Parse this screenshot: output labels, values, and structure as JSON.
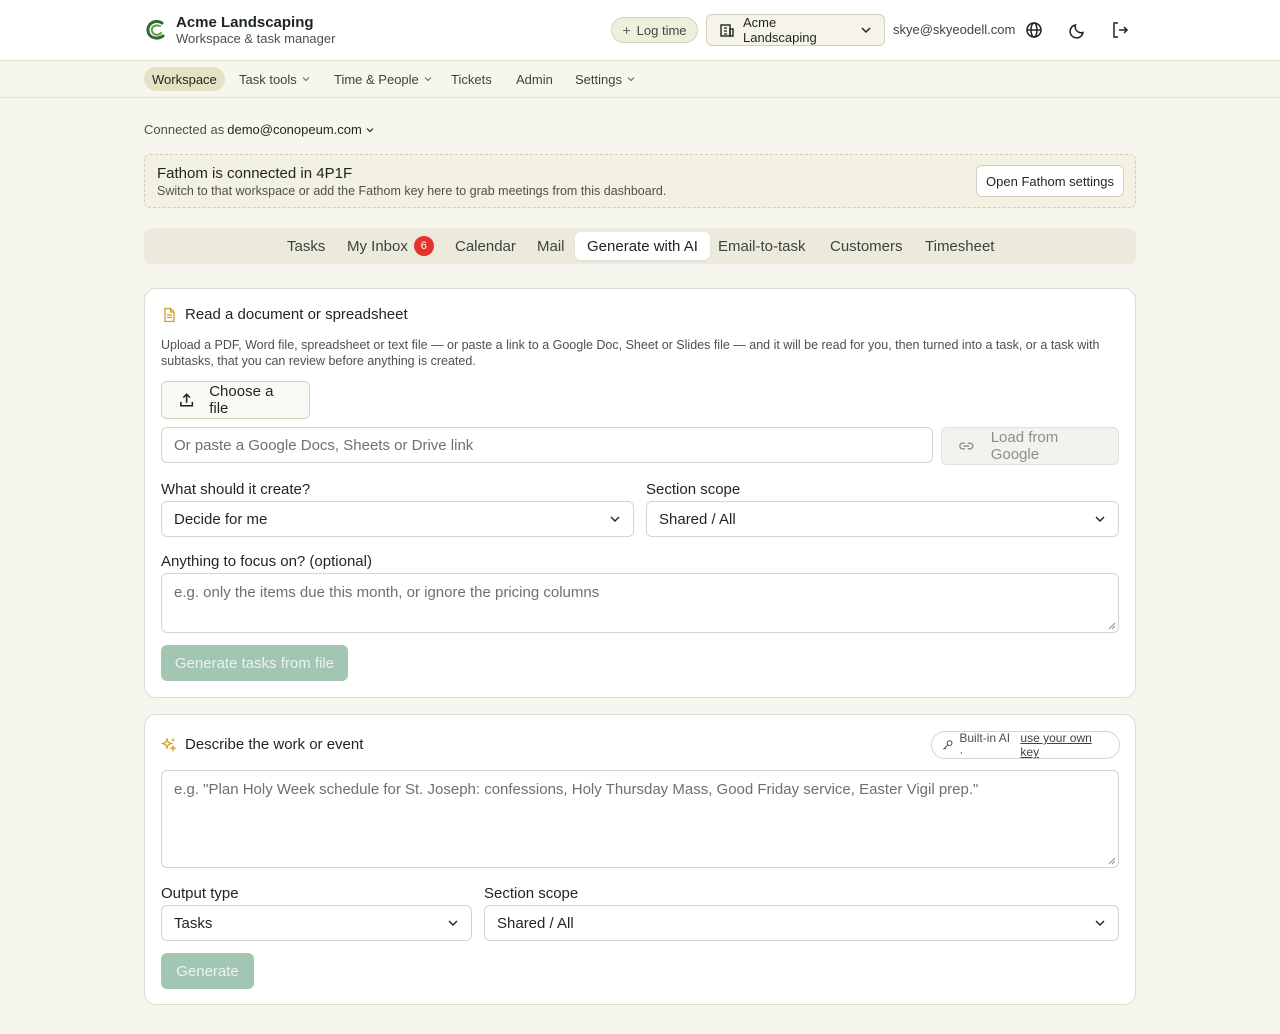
{
  "header": {
    "brand_name": "Acme Landscaping",
    "brand_sub": "Workspace & task manager",
    "log_time": "Log time",
    "workspace": "Acme Landscaping",
    "user_email": "skye@skyeodell.com",
    "icons": [
      "globe-icon",
      "moon-icon",
      "logout-icon"
    ]
  },
  "nav": {
    "items": [
      {
        "label": "Workspace",
        "active": true,
        "dropdown": false
      },
      {
        "label": "Task tools",
        "dropdown": true
      },
      {
        "label": "Time & People",
        "dropdown": true
      },
      {
        "label": "Tickets",
        "dropdown": false
      },
      {
        "label": "Admin",
        "dropdown": false
      },
      {
        "label": "Settings",
        "dropdown": true
      }
    ]
  },
  "connected": {
    "prefix": "Connected as",
    "account": "demo@conopeum.com"
  },
  "banner": {
    "title": "Fathom is connected in 4P1F",
    "subtitle": "Switch to that workspace or add the Fathom key here to grab meetings from this dashboard.",
    "button": "Open Fathom settings"
  },
  "tabs": [
    {
      "label": "Tasks"
    },
    {
      "label": "My Inbox",
      "badge": "6"
    },
    {
      "label": "Calendar"
    },
    {
      "label": "Mail"
    },
    {
      "label": "Generate with AI",
      "active": true
    },
    {
      "label": "Email-to-task"
    },
    {
      "label": "Customers"
    },
    {
      "label": "Timesheet"
    }
  ],
  "doc_card": {
    "title": "Read a document or spreadsheet",
    "description": "Upload a PDF, Word file, spreadsheet or text file — or paste a link to a Google Doc, Sheet or Slides file — and it will be read for you, then turned into a task, or a task with subtasks, that you can review before anything is created.",
    "choose_file": "Choose a file",
    "link_placeholder": "Or paste a Google Docs, Sheets or Drive link",
    "load_google": "Load from Google",
    "create_label": "What should it create?",
    "create_value": "Decide for me",
    "scope_label": "Section scope",
    "scope_value": "Shared / All",
    "focus_label": "Anything to focus on? (optional)",
    "focus_placeholder": "e.g. only the items due this month, or ignore the pricing columns",
    "generate_button": "Generate tasks from file"
  },
  "describe_card": {
    "title": "Describe the work or event",
    "ai_prefix": "Built-in AI ·",
    "ai_link": "use your own key",
    "placeholder": "e.g. \"Plan Holy Week schedule for St. Joseph: confessions, Holy Thursday Mass, Good Friday service, Easter Vigil prep.\"",
    "output_label": "Output type",
    "output_value": "Tasks",
    "scope_label": "Section scope",
    "scope_value": "Shared / All",
    "generate_button": "Generate"
  },
  "colors": {
    "accent": "#a3c6b3",
    "badge": "#e5322b",
    "nav_active": "#e6e1c2",
    "background": "#f7f6ee"
  }
}
